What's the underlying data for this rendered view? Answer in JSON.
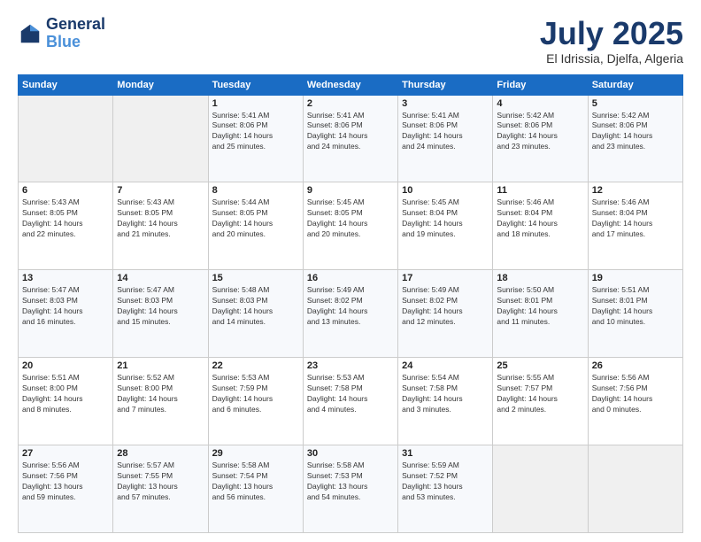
{
  "header": {
    "logo_line1": "General",
    "logo_line2": "Blue",
    "title": "July 2025",
    "subtitle": "El Idrissia, Djelfa, Algeria"
  },
  "columns": [
    "Sunday",
    "Monday",
    "Tuesday",
    "Wednesday",
    "Thursday",
    "Friday",
    "Saturday"
  ],
  "weeks": [
    [
      {
        "day": "",
        "info": ""
      },
      {
        "day": "",
        "info": ""
      },
      {
        "day": "1",
        "info": "Sunrise: 5:41 AM\nSunset: 8:06 PM\nDaylight: 14 hours\nand 25 minutes."
      },
      {
        "day": "2",
        "info": "Sunrise: 5:41 AM\nSunset: 8:06 PM\nDaylight: 14 hours\nand 24 minutes."
      },
      {
        "day": "3",
        "info": "Sunrise: 5:41 AM\nSunset: 8:06 PM\nDaylight: 14 hours\nand 24 minutes."
      },
      {
        "day": "4",
        "info": "Sunrise: 5:42 AM\nSunset: 8:06 PM\nDaylight: 14 hours\nand 23 minutes."
      },
      {
        "day": "5",
        "info": "Sunrise: 5:42 AM\nSunset: 8:06 PM\nDaylight: 14 hours\nand 23 minutes."
      }
    ],
    [
      {
        "day": "6",
        "info": "Sunrise: 5:43 AM\nSunset: 8:05 PM\nDaylight: 14 hours\nand 22 minutes."
      },
      {
        "day": "7",
        "info": "Sunrise: 5:43 AM\nSunset: 8:05 PM\nDaylight: 14 hours\nand 21 minutes."
      },
      {
        "day": "8",
        "info": "Sunrise: 5:44 AM\nSunset: 8:05 PM\nDaylight: 14 hours\nand 20 minutes."
      },
      {
        "day": "9",
        "info": "Sunrise: 5:45 AM\nSunset: 8:05 PM\nDaylight: 14 hours\nand 20 minutes."
      },
      {
        "day": "10",
        "info": "Sunrise: 5:45 AM\nSunset: 8:04 PM\nDaylight: 14 hours\nand 19 minutes."
      },
      {
        "day": "11",
        "info": "Sunrise: 5:46 AM\nSunset: 8:04 PM\nDaylight: 14 hours\nand 18 minutes."
      },
      {
        "day": "12",
        "info": "Sunrise: 5:46 AM\nSunset: 8:04 PM\nDaylight: 14 hours\nand 17 minutes."
      }
    ],
    [
      {
        "day": "13",
        "info": "Sunrise: 5:47 AM\nSunset: 8:03 PM\nDaylight: 14 hours\nand 16 minutes."
      },
      {
        "day": "14",
        "info": "Sunrise: 5:47 AM\nSunset: 8:03 PM\nDaylight: 14 hours\nand 15 minutes."
      },
      {
        "day": "15",
        "info": "Sunrise: 5:48 AM\nSunset: 8:03 PM\nDaylight: 14 hours\nand 14 minutes."
      },
      {
        "day": "16",
        "info": "Sunrise: 5:49 AM\nSunset: 8:02 PM\nDaylight: 14 hours\nand 13 minutes."
      },
      {
        "day": "17",
        "info": "Sunrise: 5:49 AM\nSunset: 8:02 PM\nDaylight: 14 hours\nand 12 minutes."
      },
      {
        "day": "18",
        "info": "Sunrise: 5:50 AM\nSunset: 8:01 PM\nDaylight: 14 hours\nand 11 minutes."
      },
      {
        "day": "19",
        "info": "Sunrise: 5:51 AM\nSunset: 8:01 PM\nDaylight: 14 hours\nand 10 minutes."
      }
    ],
    [
      {
        "day": "20",
        "info": "Sunrise: 5:51 AM\nSunset: 8:00 PM\nDaylight: 14 hours\nand 8 minutes."
      },
      {
        "day": "21",
        "info": "Sunrise: 5:52 AM\nSunset: 8:00 PM\nDaylight: 14 hours\nand 7 minutes."
      },
      {
        "day": "22",
        "info": "Sunrise: 5:53 AM\nSunset: 7:59 PM\nDaylight: 14 hours\nand 6 minutes."
      },
      {
        "day": "23",
        "info": "Sunrise: 5:53 AM\nSunset: 7:58 PM\nDaylight: 14 hours\nand 4 minutes."
      },
      {
        "day": "24",
        "info": "Sunrise: 5:54 AM\nSunset: 7:58 PM\nDaylight: 14 hours\nand 3 minutes."
      },
      {
        "day": "25",
        "info": "Sunrise: 5:55 AM\nSunset: 7:57 PM\nDaylight: 14 hours\nand 2 minutes."
      },
      {
        "day": "26",
        "info": "Sunrise: 5:56 AM\nSunset: 7:56 PM\nDaylight: 14 hours\nand 0 minutes."
      }
    ],
    [
      {
        "day": "27",
        "info": "Sunrise: 5:56 AM\nSunset: 7:56 PM\nDaylight: 13 hours\nand 59 minutes."
      },
      {
        "day": "28",
        "info": "Sunrise: 5:57 AM\nSunset: 7:55 PM\nDaylight: 13 hours\nand 57 minutes."
      },
      {
        "day": "29",
        "info": "Sunrise: 5:58 AM\nSunset: 7:54 PM\nDaylight: 13 hours\nand 56 minutes."
      },
      {
        "day": "30",
        "info": "Sunrise: 5:58 AM\nSunset: 7:53 PM\nDaylight: 13 hours\nand 54 minutes."
      },
      {
        "day": "31",
        "info": "Sunrise: 5:59 AM\nSunset: 7:52 PM\nDaylight: 13 hours\nand 53 minutes."
      },
      {
        "day": "",
        "info": ""
      },
      {
        "day": "",
        "info": ""
      }
    ]
  ]
}
